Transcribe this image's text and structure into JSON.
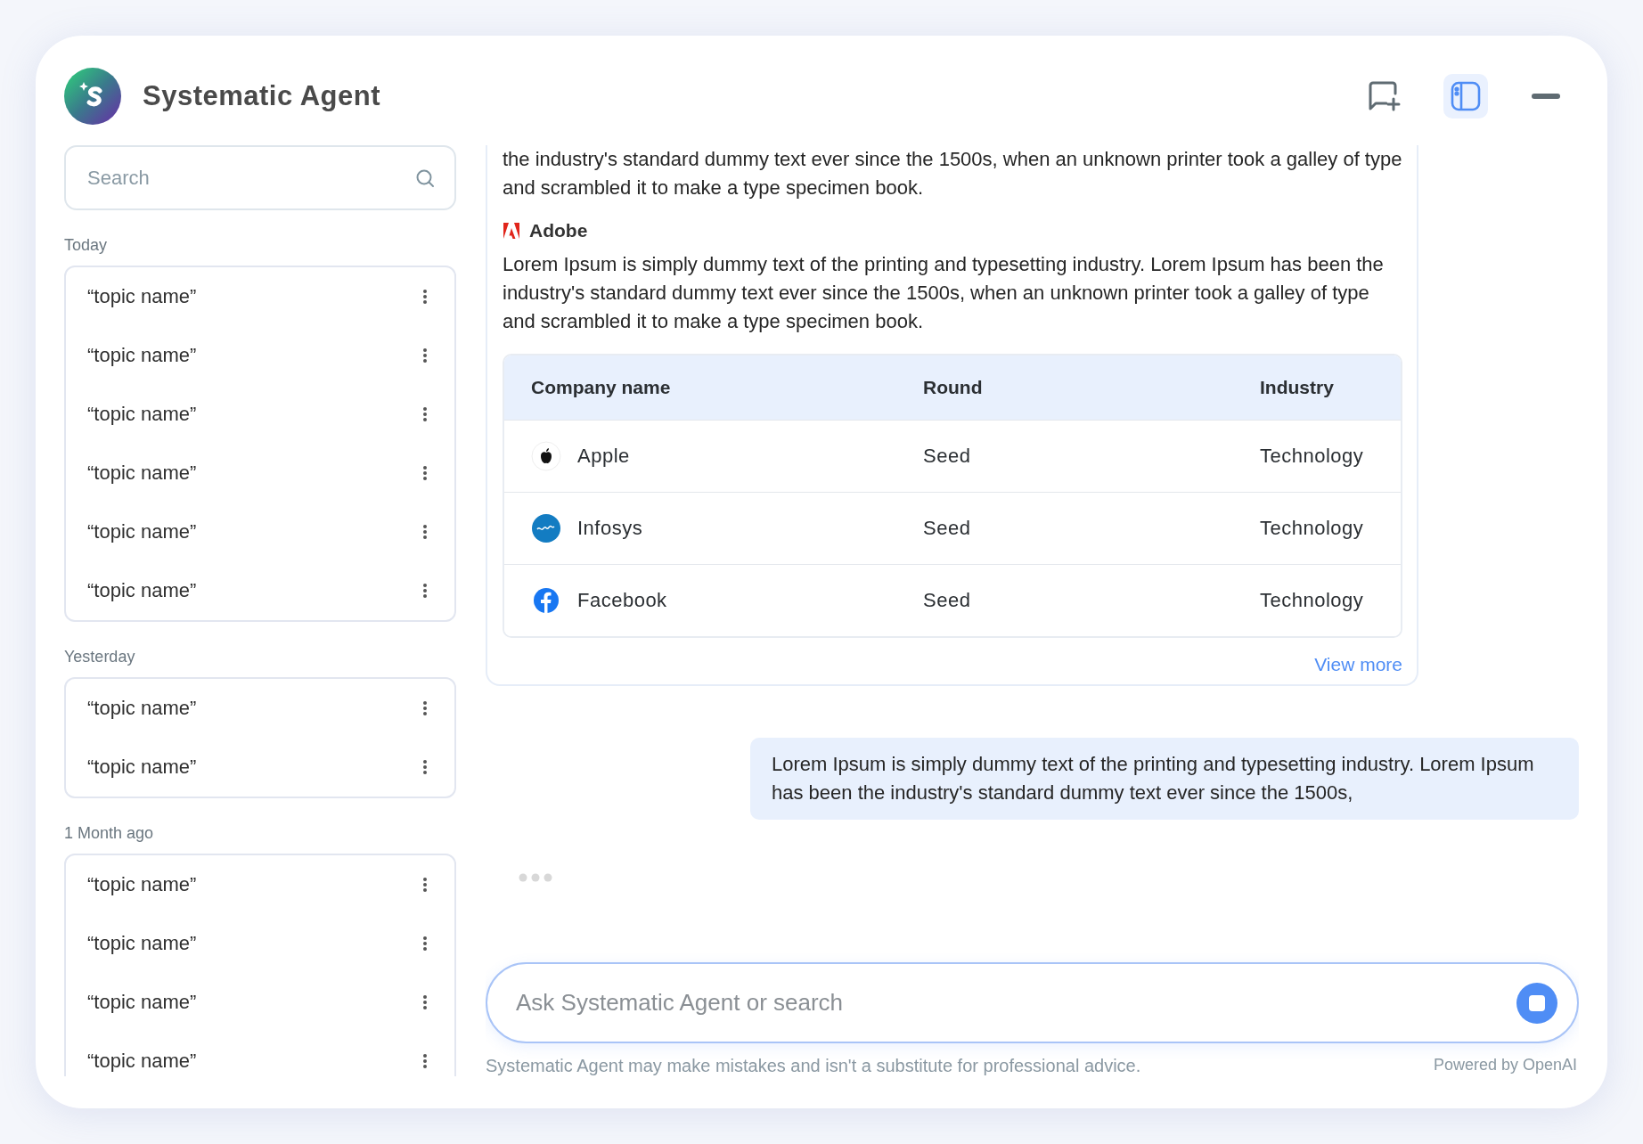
{
  "app": {
    "title": "Systematic Agent"
  },
  "header_actions": [
    {
      "kind": "new-chat",
      "selected": false
    },
    {
      "kind": "sidebar",
      "selected": true
    },
    {
      "kind": "minimize",
      "selected": false
    }
  ],
  "sidebar": {
    "search": {
      "placeholder": "Search"
    },
    "groups": [
      {
        "label": "Today",
        "topics": [
          "“topic name”",
          "“topic name”",
          "“topic name”",
          "“topic name”",
          "“topic name”",
          "“topic name”"
        ]
      },
      {
        "label": "Yesterday",
        "topics": [
          "“topic name”",
          "“topic name”"
        ]
      },
      {
        "label": "1 Month ago",
        "topics": [
          "“topic name”",
          "“topic name”",
          "“topic name”",
          "“topic name”"
        ]
      }
    ]
  },
  "chat": {
    "answer": {
      "intro": "the industry's standard dummy text ever since the 1500s, when an unknown printer took a galley of type and scrambled it to make a type specimen book.",
      "source": {
        "name": "Adobe"
      },
      "body": "Lorem Ipsum is simply dummy text of the printing and typesetting industry. Lorem Ipsum has been the industry's standard dummy text ever since the 1500s, when an unknown printer took a galley of type and scrambled it to make a type specimen book.",
      "table": {
        "columns": [
          "Company name",
          "Round",
          "Industry"
        ],
        "rows": [
          {
            "kind": "apple",
            "company": "Apple",
            "round": "Seed",
            "industry": "Technology"
          },
          {
            "kind": "infosys",
            "company": "Infosys",
            "round": "Seed",
            "industry": "Technology"
          },
          {
            "kind": "facebook",
            "company": "Facebook",
            "round": "Seed",
            "industry": "Technology"
          }
        ]
      },
      "view_more": "View more"
    },
    "user_message": "Lorem Ipsum is simply dummy text of the printing and typesetting industry. Lorem Ipsum has been the industry's standard dummy text ever since the 1500s,",
    "typing": true
  },
  "composer": {
    "placeholder": "Ask Systematic Agent or search"
  },
  "footer": {
    "disclaimer": "Systematic Agent may make mistakes and isn't a substitute for professional advice.",
    "powered_by": "Powered by OpenAI"
  }
}
